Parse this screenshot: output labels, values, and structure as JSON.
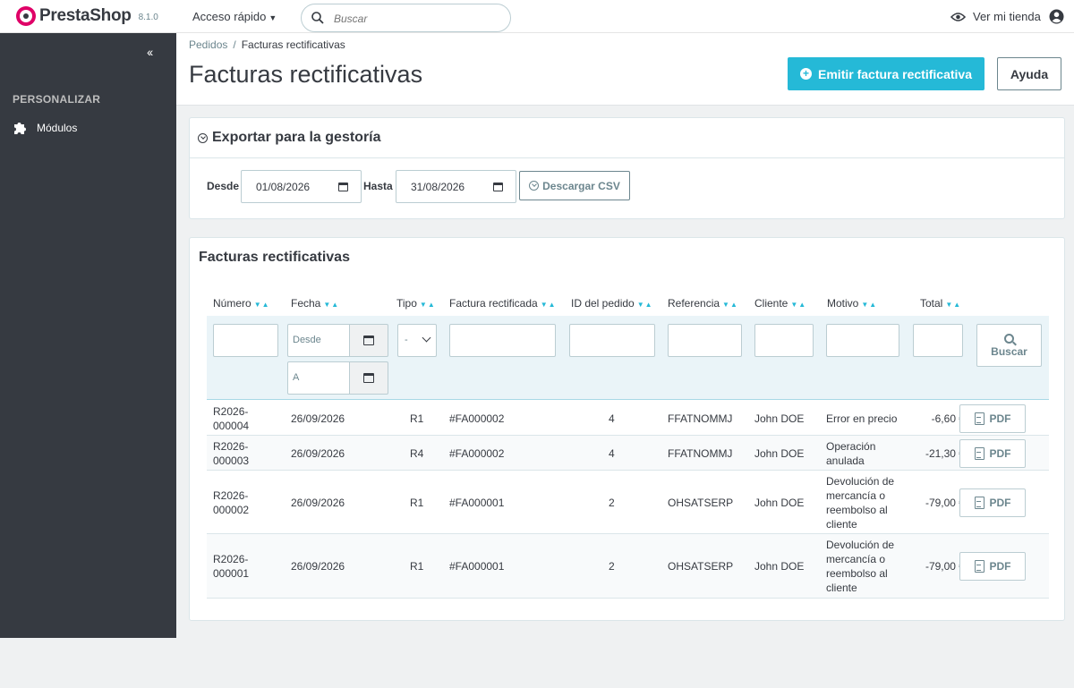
{
  "header": {
    "brand": "PrestaShop",
    "version": "8.1.0",
    "quick_access": "Acceso rápido",
    "search_placeholder": "Buscar",
    "view_shop": "Ver mi tienda"
  },
  "sidebar": {
    "section_title": "PERSONALIZAR",
    "items": [
      {
        "label": "Módulos",
        "icon": "puzzle-icon"
      }
    ]
  },
  "page": {
    "breadcrumb": [
      "Pedidos",
      "Facturas rectificativas"
    ],
    "title": "Facturas rectificativas",
    "primary_button": "Emitir factura rectificativa",
    "help_button": "Ayuda"
  },
  "export": {
    "title": "Exportar para la gestoría",
    "from_label": "Desde",
    "from_value": "01/08/2026",
    "to_label": "Hasta",
    "to_value": "31/08/2026",
    "csv_button": "Descargar CSV"
  },
  "list": {
    "title": "Facturas rectificativas",
    "columns": [
      "Número",
      "Fecha",
      "Tipo",
      "Factura rectificada",
      "ID del pedido",
      "Referencia",
      "Cliente",
      "Motivo",
      "Total"
    ],
    "filters": {
      "date_from_placeholder": "Desde",
      "date_to_placeholder": "A",
      "type_selected": "-",
      "search_button": "Buscar"
    },
    "pdf_label": "PDF",
    "rows": [
      {
        "numero": "R2026-\n000004",
        "fecha": "26/09/2026",
        "tipo": "R1",
        "factura": "#FA000002",
        "id_pedido": "4",
        "referencia": "FFATNOMMJ",
        "cliente": "John DOE",
        "motivo": "Error en precio",
        "total": "-6,60 €"
      },
      {
        "numero": "R2026-\n000003",
        "fecha": "26/09/2026",
        "tipo": "R4",
        "factura": "#FA000002",
        "id_pedido": "4",
        "referencia": "FFATNOMMJ",
        "cliente": "John DOE",
        "motivo": "Operación\nanulada",
        "total": "-21,30 €"
      },
      {
        "numero": "R2026-\n000002",
        "fecha": "26/09/2026",
        "tipo": "R1",
        "factura": "#FA000001",
        "id_pedido": "2",
        "referencia": "OHSATSERP",
        "cliente": "John DOE",
        "motivo": "Devolución de\nmercancía o\nreembolso al\ncliente",
        "total": "-79,00 €"
      },
      {
        "numero": "R2026-\n000001",
        "fecha": "26/09/2026",
        "tipo": "R1",
        "factura": "#FA000001",
        "id_pedido": "2",
        "referencia": "OHSATSERP",
        "cliente": "John DOE",
        "motivo": "Devolución de\nmercancía o\nreembolso al\ncliente",
        "total": "-79,00 €"
      }
    ]
  }
}
